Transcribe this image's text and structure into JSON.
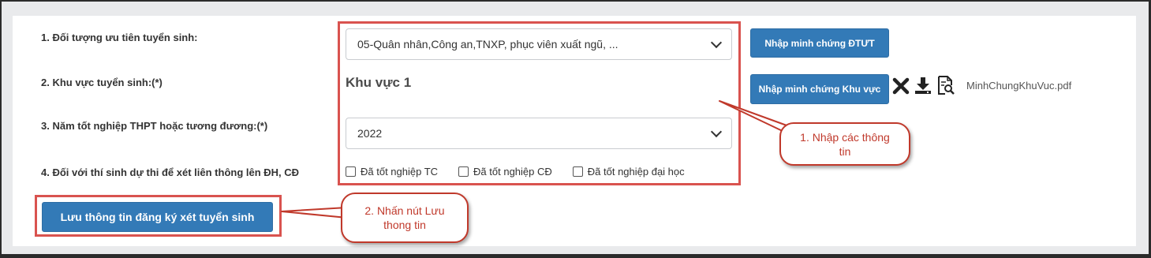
{
  "form": {
    "priority_label": "1. Đối tượng ưu tiên tuyển sinh:",
    "priority_value": "05-Quân nhân,Công an,TNXP, phục viên xuất ngũ, ...",
    "region_label": "2. Khu vực tuyển sinh:(*)",
    "region_value": "Khu vực 1",
    "grad_year_label": "3. Năm tốt nghiệp THPT hoặc tương đương:(*)",
    "grad_year_value": "2022",
    "transfer_label": "4. Đối với thí sinh dự thi để xét liên thông lên ĐH, CĐ",
    "checkboxes": [
      "Đã tốt nghiệp TC",
      "Đã tốt nghiệp CĐ",
      "Đã tốt nghiệp đại học"
    ],
    "save_button": "Lưu thông tin đăng ký xét tuyển sinh"
  },
  "evidence": {
    "priority_button": "Nhập minh chứng ĐTƯT",
    "region_button": "Nhập minh chứng Khu vực",
    "file_name": "MinhChungKhuVuc.pdf",
    "icons": [
      "close-icon",
      "download-icon",
      "preview-icon"
    ]
  },
  "callouts": {
    "step1": "1. Nhập các thông tin",
    "step2": "2. Nhấn nút Lưu thong tin"
  },
  "colors": {
    "primary": "#337ab7",
    "highlight": "#d9534f",
    "callout_text": "#c0392b"
  }
}
